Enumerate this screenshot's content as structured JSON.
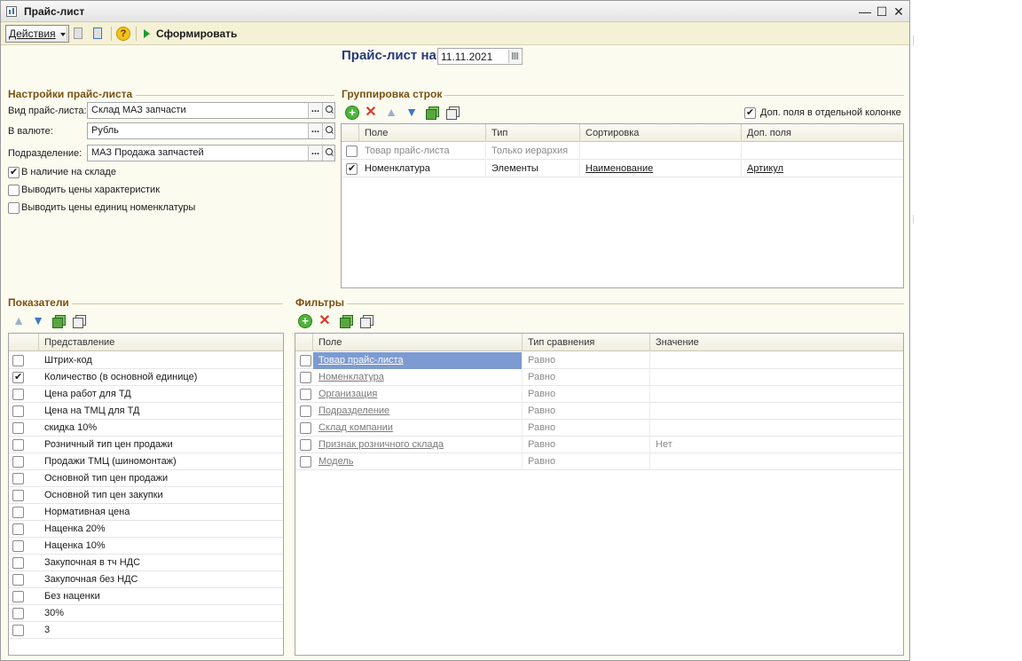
{
  "window": {
    "title": "Прайс-лист",
    "minimize": "—",
    "maximize": "☐",
    "close": "✕"
  },
  "toolbar": {
    "actions": "Действия",
    "generate": "Сформировать",
    "help": "?"
  },
  "header": {
    "title": "Прайс-лист на",
    "date": "11.11.2021"
  },
  "settings": {
    "section": "Настройки прайс-листа",
    "kind_label": "Вид прайс-листа:",
    "kind_value": "Склад МАЗ запчасти",
    "currency_label": "В валюте:",
    "currency_value": "Рубль",
    "division_label": "Подразделение:",
    "division_value": "МАЗ Продажа запчастей",
    "dots": "...",
    "checks": [
      {
        "label": "В наличие на складе",
        "checked": true
      },
      {
        "label": "Выводить цены характеристик",
        "checked": false
      },
      {
        "label": "Выводить цены единиц номенклатуры",
        "checked": false
      }
    ]
  },
  "grouping": {
    "section": "Группировка строк",
    "extra_fields_label": "Доп. поля в отдельной колонке",
    "extra_fields_checked": true,
    "columns": [
      "Поле",
      "Тип",
      "Сортировка",
      "Доп. поля"
    ],
    "rows": [
      {
        "checked": false,
        "field": "Товар прайс-листа",
        "type": "Только иерархия",
        "sort": "",
        "extra": "",
        "muted": true
      },
      {
        "checked": true,
        "field": "Номенклатура",
        "type": "Элементы",
        "sort": "Наименование",
        "extra": "Артикул",
        "muted": false
      }
    ]
  },
  "indicators": {
    "section": "Показатели",
    "column": "Представление",
    "rows": [
      {
        "checked": false,
        "label": "Штрих-код"
      },
      {
        "checked": true,
        "label": "Количество (в основной единице)"
      },
      {
        "checked": false,
        "label": "Цена работ для ТД"
      },
      {
        "checked": false,
        "label": "Цена на ТМЦ для ТД"
      },
      {
        "checked": false,
        "label": "скидка 10%"
      },
      {
        "checked": false,
        "label": "Розничный тип цен продажи"
      },
      {
        "checked": false,
        "label": "Продажи ТМЦ (шиномонтаж)"
      },
      {
        "checked": false,
        "label": "Основной тип цен продажи"
      },
      {
        "checked": false,
        "label": "Основной тип цен закупки"
      },
      {
        "checked": false,
        "label": "Нормативная цена"
      },
      {
        "checked": false,
        "label": "Наценка 20%"
      },
      {
        "checked": false,
        "label": "Наценка 10%"
      },
      {
        "checked": false,
        "label": "Закупочная в тч НДС"
      },
      {
        "checked": false,
        "label": "Закупочная без НДС"
      },
      {
        "checked": false,
        "label": "Без наценки"
      },
      {
        "checked": false,
        "label": "30%"
      },
      {
        "checked": false,
        "label": "3"
      }
    ]
  },
  "filters": {
    "section": "Фильтры",
    "columns": [
      "Поле",
      "Тип сравнения",
      "Значение"
    ],
    "rows": [
      {
        "checked": false,
        "field": "Товар прайс-листа",
        "cmp": "Равно",
        "value": "",
        "selected": true
      },
      {
        "checked": false,
        "field": "Номенклатура",
        "cmp": "Равно",
        "value": "",
        "selected": false
      },
      {
        "checked": false,
        "field": "Организация",
        "cmp": "Равно",
        "value": "",
        "selected": false
      },
      {
        "checked": false,
        "field": "Подразделение",
        "cmp": "Равно",
        "value": "",
        "selected": false
      },
      {
        "checked": false,
        "field": "Склад компании",
        "cmp": "Равно",
        "value": "",
        "selected": false
      },
      {
        "checked": false,
        "field": "Признак розничного склада",
        "cmp": "Равно",
        "value": "Нет",
        "selected": false
      },
      {
        "checked": false,
        "field": "Модель",
        "cmp": "Равно",
        "value": "",
        "selected": false
      }
    ]
  }
}
